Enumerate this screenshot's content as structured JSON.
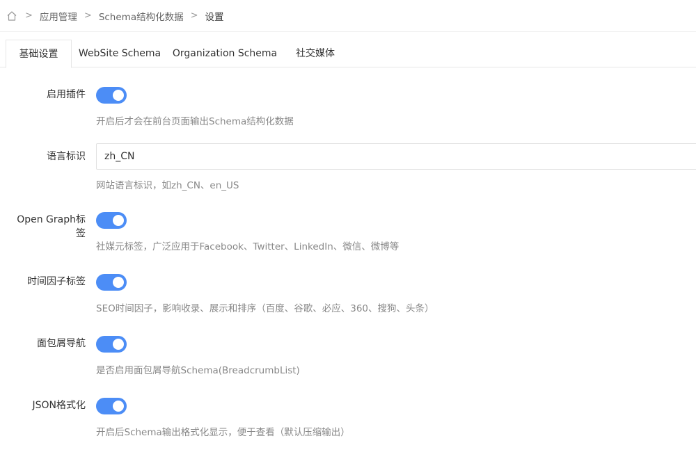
{
  "breadcrumb": {
    "items": [
      "应用管理",
      "Schema结构化数据",
      "设置"
    ],
    "separator": ">"
  },
  "tabs": [
    {
      "label": "基础设置",
      "active": true
    },
    {
      "label": "WebSite Schema",
      "active": false
    },
    {
      "label": "Organization Schema",
      "active": false
    },
    {
      "label": "社交媒体",
      "active": false
    }
  ],
  "form": {
    "enable_plugin": {
      "label": "启用插件",
      "on": true,
      "help": "开启后才会在前台页面输出Schema结构化数据"
    },
    "language": {
      "label": "语言标识",
      "value": "zh_CN",
      "help": "网站语言标识，如zh_CN、en_US"
    },
    "open_graph": {
      "label_line1": "Open Graph标",
      "label_line2": "签",
      "on": true,
      "help": "社媒元标签，广泛应用于Facebook、Twitter、LinkedIn、微信、微博等"
    },
    "time_factor": {
      "label": "时间因子标签",
      "on": true,
      "help": "SEO时间因子，影响收录、展示和排序（百度、谷歌、必应、360、搜狗、头条）"
    },
    "breadcrumb_nav": {
      "label": "面包屑导航",
      "on": true,
      "help": "是否启用面包屑导航Schema(BreadcrumbList)"
    },
    "json_format": {
      "label": "JSON格式化",
      "on": true,
      "help": "开启后Schema输出格式化显示，便于查看（默认压缩输出）"
    }
  },
  "colors": {
    "accent": "#4c8df6",
    "help_text": "#888888",
    "border": "#e6e6e6"
  }
}
